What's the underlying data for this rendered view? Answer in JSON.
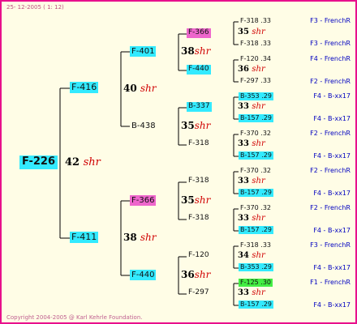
{
  "header": "25- 12-2005 ( 1: 12)",
  "copyright": "Copyright 2004-2005 @ Karl Kehrle Foundation.",
  "root": {
    "label": "F-226",
    "gen_num": "42",
    "gen_suffix": "shr"
  },
  "gen2": [
    {
      "label": "F-416",
      "gen_num": "40",
      "gen_suffix": "shr"
    },
    {
      "label": "F-411",
      "gen_num": "38",
      "gen_suffix": "shr"
    }
  ],
  "gen3": [
    {
      "label": "F-401",
      "gen_num": "38",
      "gen_suffix": "shr"
    },
    {
      "label": "B-438",
      "gen_num": "35",
      "gen_suffix": "shr"
    },
    {
      "label": "F-366",
      "gen_num": "35",
      "gen_suffix": "shr"
    },
    {
      "label": "F-440",
      "gen_num": "36",
      "gen_suffix": "shr"
    }
  ],
  "gen4": [
    {
      "label": "F-366",
      "gen_num": "35",
      "gen_suffix": "shr"
    },
    {
      "label": "F-440",
      "gen_num": "36",
      "gen_suffix": "shr"
    },
    {
      "label": "B-337",
      "gen_num": "33",
      "gen_suffix": "shr"
    },
    {
      "label": "F-318",
      "gen_num": "33",
      "gen_suffix": "shr"
    },
    {
      "label": "F-318",
      "gen_num": "33",
      "gen_suffix": "shr"
    },
    {
      "label": "F-318",
      "gen_num": "33",
      "gen_suffix": "shr"
    },
    {
      "label": "F-120",
      "gen_num": "34",
      "gen_suffix": "shr"
    },
    {
      "label": "F-297",
      "gen_num": "33",
      "gen_suffix": "shr"
    }
  ],
  "gen5": [
    {
      "label": "F-318 .33"
    },
    {
      "label": "F-318 .33"
    },
    {
      "label": "F-120 .34"
    },
    {
      "label": "F-297 .33"
    },
    {
      "label": "B-353 .29"
    },
    {
      "label": "B-157 .29"
    },
    {
      "label": "F-370 .32"
    },
    {
      "label": "B-157 .29"
    },
    {
      "label": "F-370 .32"
    },
    {
      "label": "B-157 .29"
    },
    {
      "label": "F-370 .32"
    },
    {
      "label": "B-157 .29"
    },
    {
      "label": "F-318 .33"
    },
    {
      "label": "B-353 .29"
    },
    {
      "label": "F-125 .30"
    },
    {
      "label": "B-157 .29"
    }
  ],
  "notes": [
    "F3 - FrenchR",
    "F3 - FrenchR",
    "F4 - FrenchR",
    "F2 - FrenchR",
    "F4 - B-xx17",
    "F4 - B-xx17",
    "F2 - FrenchR",
    "F4 - B-xx17",
    "F2 - FrenchR",
    "F4 - B-xx17",
    "F2 - FrenchR",
    "F4 - B-xx17",
    "F3 - FrenchR",
    "F4 - B-xx17",
    "F1 - FrenchR",
    "F4 - B-xx17"
  ],
  "colors": {
    "border": "#e8108c",
    "cyan": "#33eaff",
    "pink": "#ee66cc",
    "green": "#44ee44",
    "shr": "#d00000",
    "note": "#0000c0",
    "background": "#fffde6"
  }
}
